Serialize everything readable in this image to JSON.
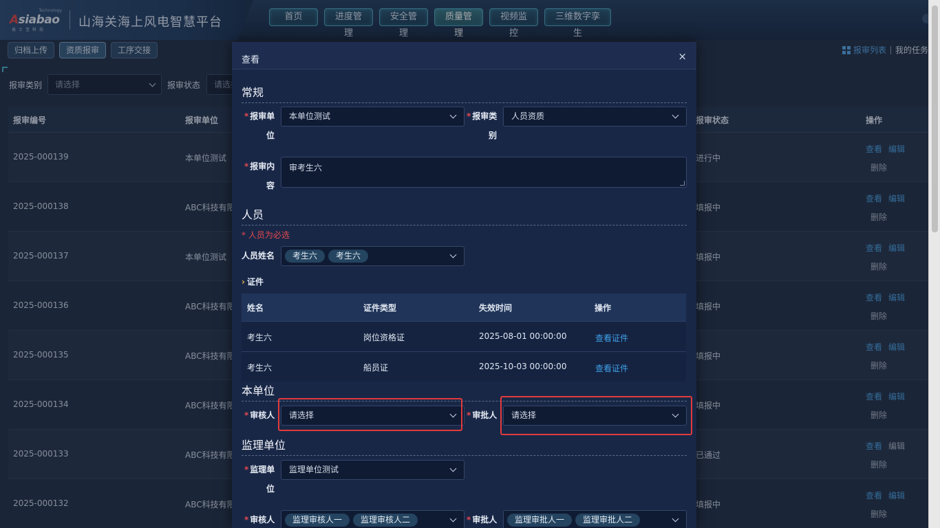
{
  "brand": {
    "logo_tm": "Technology",
    "logo_word_a": "A",
    "logo_word_rest": "siabao",
    "logo_sub": "易士宝科技",
    "title": "山海关海上风电智慧平台"
  },
  "nav": [
    {
      "label": "首页"
    },
    {
      "label": "进度管理"
    },
    {
      "label": "安全管理"
    },
    {
      "label": "质量管理"
    },
    {
      "label": "视频监控"
    },
    {
      "label": "三维数字孪生"
    }
  ],
  "subtabs": [
    {
      "label": "归档上传"
    },
    {
      "label": "资质报审"
    },
    {
      "label": "工序交接"
    }
  ],
  "right_links": {
    "review_list": "报审列表",
    "my_tasks": "我的任务"
  },
  "filters": {
    "category_label": "报审类别",
    "category_placeholder": "请选择",
    "status_label": "报审状态",
    "status_placeholder": "请选择"
  },
  "table": {
    "headers": [
      "报审编号",
      "报审单位",
      "报审状态",
      "操作"
    ],
    "rows": [
      {
        "no": "2025-000139",
        "unit": "本单位测试",
        "status": "进行中",
        "op_view": "查看",
        "op_edit": "编辑",
        "op_delete": "删除"
      },
      {
        "no": "2025-000138",
        "unit": "ABC科技有限",
        "status": "填报中",
        "op_view": "查看",
        "op_edit": "编辑",
        "op_delete": "删除"
      },
      {
        "no": "2025-000137",
        "unit": "本单位测试",
        "status": "填报中",
        "op_view": "查看",
        "op_edit": "编辑",
        "op_delete": "删除"
      },
      {
        "no": "2025-000136",
        "unit": "ABC科技有限",
        "status": "填报中",
        "op_view": "查看",
        "op_edit": "编辑",
        "op_delete": "删除"
      },
      {
        "no": "2025-000135",
        "unit": "ABC科技有限",
        "status": "填报中",
        "op_view": "查看",
        "op_edit": "编辑",
        "op_delete": "删除"
      },
      {
        "no": "2025-000134",
        "unit": "ABC科技有限",
        "status": "填报中",
        "op_view": "查看",
        "op_edit": "编辑",
        "op_delete": "删除"
      },
      {
        "no": "2025-000133",
        "unit": "ABC科技有限",
        "status": "已通过",
        "op_view": "查看",
        "op_edit": "编辑",
        "op_delete": "删除"
      },
      {
        "no": "2025-000132",
        "unit": "ABC科技有限",
        "status": "填报中",
        "op_view": "查看",
        "op_edit": "编辑",
        "op_delete": "删除"
      }
    ]
  },
  "modal": {
    "title": "查看",
    "close": "×",
    "sections": {
      "general": "常规",
      "personnel": "人员",
      "own_unit": "本单位",
      "supervision": "监理单位"
    },
    "general": {
      "unit_label_1": "报审单",
      "unit_label_2": "位",
      "unit_value": "本单位测试",
      "category_label_1": "报审类",
      "category_label_2": "别",
      "category_value": "人员资质",
      "content_label_1": "报审内",
      "content_label_2": "容",
      "content_value": "审考生六"
    },
    "personnel": {
      "hint": "* 人员为必选",
      "name_label": "人员姓名",
      "tags": [
        "考生六",
        "考生六"
      ],
      "cert_caption": "证件",
      "cert_headers": [
        "姓名",
        "证件类型",
        "失效时间",
        "操作"
      ],
      "cert_rows": [
        {
          "name": "考生六",
          "type": "岗位资格证",
          "expire": "2025-08-01 00:00:00",
          "action": "查看证件"
        },
        {
          "name": "考生六",
          "type": "船员证",
          "expire": "2025-10-03 00:00:00",
          "action": "查看证件"
        }
      ]
    },
    "own_unit": {
      "reviewer_label": "审核人",
      "reviewer_placeholder": "请选择",
      "approver_label": "审批人",
      "approver_placeholder": "请选择"
    },
    "supervision": {
      "unit_label_1": "监理单",
      "unit_label_2": "位",
      "unit_value": "监理单位测试",
      "reviewer_label": "审核人",
      "reviewer_tags": [
        "监理审核人一",
        "监理审核人二"
      ],
      "approver_label": "审批人",
      "approver_tags": [
        "监理审批人一",
        "监理审批人二"
      ]
    }
  },
  "colors": {
    "accent": "#4ea3e3",
    "required": "#e5484d",
    "highlight": "#e23b3b"
  }
}
